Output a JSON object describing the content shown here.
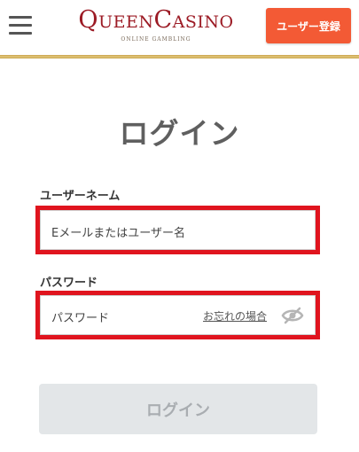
{
  "header": {
    "logo_main_first": "Q",
    "logo_main_mid": "UEEN",
    "logo_main_second": "C",
    "logo_main_end": "ASINO",
    "logo_sub": "ONLINE GAMBLING",
    "signup_label": "ユーザー登録",
    "menu_icon": "hamburger-menu-icon",
    "accent_gold": "#c8a24a",
    "signup_color": "#f35a35"
  },
  "login": {
    "title": "ログイン",
    "username_label": "ユーザーネーム",
    "username_placeholder": "Eメールまたはユーザー名",
    "password_label": "パスワード",
    "password_placeholder": "パスワード",
    "forgot_label": "お忘れの場合",
    "eye_icon": "eye-off-icon",
    "submit_label": "ログイン",
    "highlight_color": "#e0141e"
  }
}
